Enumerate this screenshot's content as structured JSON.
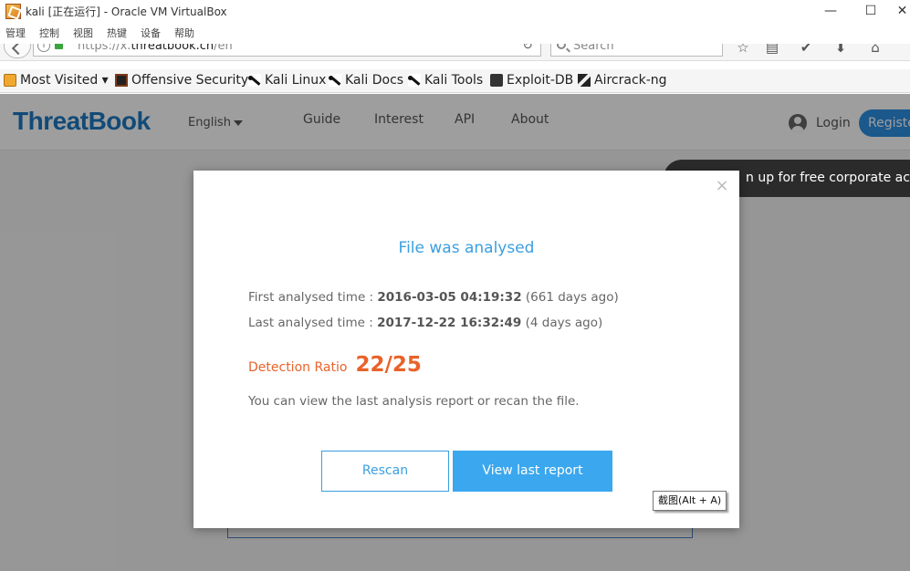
{
  "window": {
    "title": "kali [正在运行] - Oracle VM VirtualBox",
    "minimize": "—",
    "maximize": "☐",
    "close": "✕"
  },
  "vbox_menu": [
    "管理",
    "控制",
    "视图",
    "热键",
    "设备",
    "帮助"
  ],
  "browser": {
    "url_prefix": "https://x.",
    "url_domain": "threatbook.cn",
    "url_path": "/en",
    "search_placeholder": "Search",
    "bookmarks": [
      {
        "label": "Most Visited ▾",
        "icon": "folder-icon"
      },
      {
        "label": "Offensive Security",
        "icon": "offsec-icon"
      },
      {
        "label": "Kali Linux",
        "icon": "kali-dragon-icon"
      },
      {
        "label": "Kali Docs",
        "icon": "kali-dragon-icon"
      },
      {
        "label": "Kali Tools",
        "icon": "kali-dragon-icon"
      },
      {
        "label": "Exploit-DB",
        "icon": "exploitdb-icon"
      },
      {
        "label": "Aircrack-ng",
        "icon": "aircrack-icon"
      }
    ]
  },
  "site": {
    "logo": "ThreatBook",
    "language": "English",
    "nav": [
      "Guide",
      "Interest",
      "API",
      "About"
    ],
    "login": "Login",
    "register": "Register",
    "promo": "n up for free corporate account"
  },
  "modal": {
    "close": "×",
    "title": "File was analysed",
    "first_label": "First analysed time : ",
    "first_value": "2016-03-05 04:19:32",
    "first_ago": " (661 days ago)",
    "last_label": "Last analysed time : ",
    "last_value": "2017-12-22 16:32:49",
    "last_ago": " (4 days ago)",
    "detection_label": "Detection Ratio",
    "detection_ratio": "22/25",
    "description": "You can view the last analysis report or recan the file.",
    "rescan": "Rescan",
    "view_report": "View last report"
  },
  "tooltip": "截图(Alt + A)",
  "colors": {
    "accent": "#3a9fe0",
    "detection": "#e8622a",
    "logo": "#1e78c0"
  }
}
